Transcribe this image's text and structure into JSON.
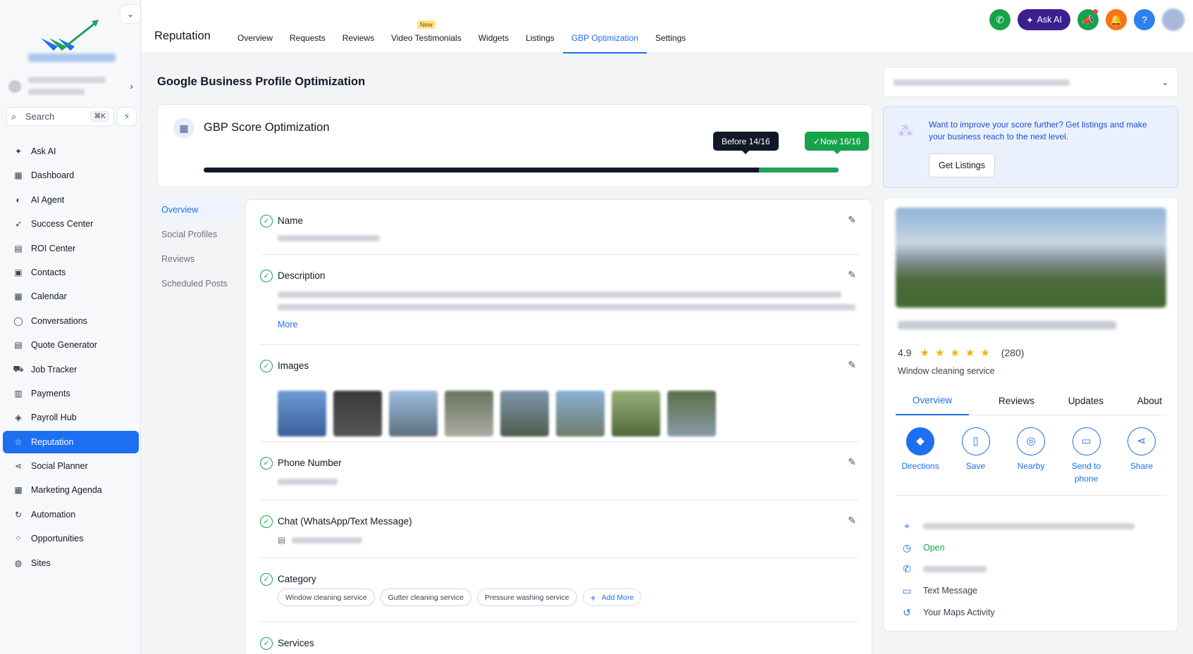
{
  "sidebar": {
    "search_placeholder": "Search",
    "search_shortcut": "⌘K",
    "items": [
      {
        "label": "Ask AI",
        "icon": "sparkle-icon"
      },
      {
        "label": "Dashboard",
        "icon": "grid-icon"
      },
      {
        "label": "AI Agent",
        "icon": "agent-icon"
      },
      {
        "label": "Success Center",
        "icon": "rocket-icon"
      },
      {
        "label": "ROI Center",
        "icon": "chart-icon"
      },
      {
        "label": "Contacts",
        "icon": "contacts-icon"
      },
      {
        "label": "Calendar",
        "icon": "calendar-icon"
      },
      {
        "label": "Conversations",
        "icon": "chat-icon"
      },
      {
        "label": "Quote Generator",
        "icon": "quote-icon"
      },
      {
        "label": "Job Tracker",
        "icon": "tracker-icon"
      },
      {
        "label": "Payments",
        "icon": "payments-icon"
      },
      {
        "label": "Payroll Hub",
        "icon": "payroll-icon"
      },
      {
        "label": "Reputation",
        "icon": "star-icon",
        "active": true
      },
      {
        "label": "Social Planner",
        "icon": "share-icon"
      },
      {
        "label": "Marketing Agenda",
        "icon": "agenda-icon"
      },
      {
        "label": "Automation",
        "icon": "automation-icon"
      },
      {
        "label": "Opportunities",
        "icon": "opportunities-icon"
      },
      {
        "label": "Sites",
        "icon": "globe-icon"
      }
    ]
  },
  "header": {
    "title": "Reputation",
    "tabs": [
      {
        "label": "Overview"
      },
      {
        "label": "Requests"
      },
      {
        "label": "Reviews"
      },
      {
        "label": "Video Testimonials",
        "badge": "New"
      },
      {
        "label": "Widgets"
      },
      {
        "label": "Listings"
      },
      {
        "label": "GBP Optimization",
        "active": true
      },
      {
        "label": "Settings"
      }
    ],
    "ask_ai_label": "Ask AI",
    "help_label": "?"
  },
  "main": {
    "heading": "Google Business Profile Optimization",
    "score": {
      "title": "GBP Score Optimization",
      "before_label": "Before 14/16",
      "now_label": "✓Now 16/16",
      "before_value": 14,
      "now_value": 16,
      "total": 16
    },
    "subnav": [
      {
        "label": "Overview",
        "active": true
      },
      {
        "label": "Social Profiles"
      },
      {
        "label": "Reviews"
      },
      {
        "label": "Scheduled Posts"
      }
    ],
    "fields": {
      "name": "Name",
      "description": "Description",
      "more": "More",
      "images": "Images",
      "phone": "Phone Number",
      "chat": "Chat (WhatsApp/Text Message)",
      "category": "Category",
      "services": "Services"
    },
    "categories": [
      "Window cleaning service",
      "Gutter cleaning service",
      "Pressure washing service"
    ],
    "add_more": "Add More"
  },
  "right": {
    "promo_text": "Want to improve your score further? Get listings and make your business reach to the next level.",
    "promo_button": "Get Listings",
    "rating": "4.9",
    "stars": "★★★★★",
    "review_count": "(280)",
    "category": "Window cleaning service",
    "tabs": [
      "Overview",
      "Reviews",
      "Updates",
      "About"
    ],
    "actions": [
      "Directions",
      "Save",
      "Nearby",
      "Send to phone",
      "Share"
    ],
    "open_label": "Open",
    "text_message": "Text Message",
    "maps_activity": "Your Maps Activity"
  },
  "colors": {
    "accent": "#1d6ff2",
    "success": "#16a34a",
    "dark": "#111827",
    "ask_ai": "#3b1f8f",
    "notify": "#f97316"
  }
}
